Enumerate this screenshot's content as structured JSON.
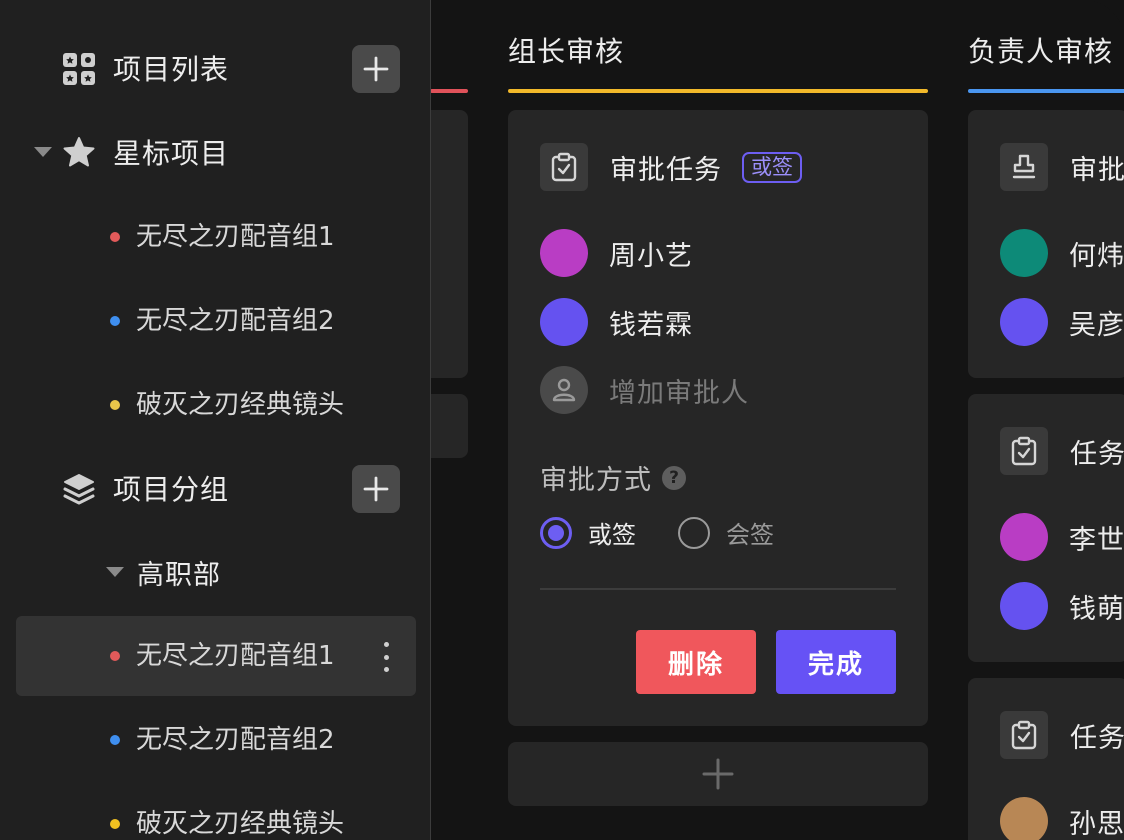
{
  "sidebar": {
    "project_list": {
      "label": "项目列表",
      "icon": "grid-icon"
    },
    "starred": {
      "label": "星标项目",
      "icon": "star-icon",
      "items": [
        {
          "label": "无尽之刃配音组1",
          "dot": "#e25a5a"
        },
        {
          "label": "无尽之刃配音组2",
          "dot": "#3f8ff0"
        },
        {
          "label": "破灭之刃经典镜头",
          "dot": "#e8c54a"
        }
      ]
    },
    "groups": {
      "label": "项目分组",
      "icon": "layers-icon",
      "department": "高职部",
      "items": [
        {
          "label": "无尽之刃配音组1",
          "dot": "#e25a5a",
          "active": true
        },
        {
          "label": "无尽之刃配音组2",
          "dot": "#3f8ff0"
        },
        {
          "label": "破灭之刃经典镜头",
          "dot": "#f0c020"
        }
      ]
    }
  },
  "columns": [
    {
      "accent": "#e0525a"
    },
    {
      "title": "组长审核",
      "accent": "#f2b92a",
      "card": {
        "title": "审批任务",
        "tag": "或签",
        "approvers": [
          {
            "name": "周小艺",
            "color": "#b93dc4"
          },
          {
            "name": "钱若霖",
            "color": "#6552f0"
          }
        ],
        "add_label": "增加审批人",
        "method_label": "审批方式",
        "options": [
          {
            "label": "或签",
            "selected": true
          },
          {
            "label": "会签",
            "selected": false
          }
        ],
        "delete_label": "删除",
        "done_label": "完成",
        "delete_color": "#f0575c",
        "done_color": "#6652f5"
      }
    },
    {
      "title": "负责人审核",
      "accent": "#4a96f0",
      "cards": [
        {
          "title": "审批",
          "icon": "stamp-icon",
          "people": [
            {
              "name": "何炜",
              "color": "#0d8a78"
            },
            {
              "name": "吴彦",
              "color": "#6552f0"
            }
          ]
        },
        {
          "title": "任务",
          "icon": "clipboard-check-icon",
          "people": [
            {
              "name": "李世",
              "color": "#b93dc4"
            },
            {
              "name": "钱萌",
              "color": "#6552f0"
            }
          ]
        },
        {
          "title": "任务",
          "icon": "clipboard-check-icon",
          "people": [
            {
              "name": "孙思",
              "color": "#b88755"
            }
          ]
        }
      ]
    }
  ]
}
